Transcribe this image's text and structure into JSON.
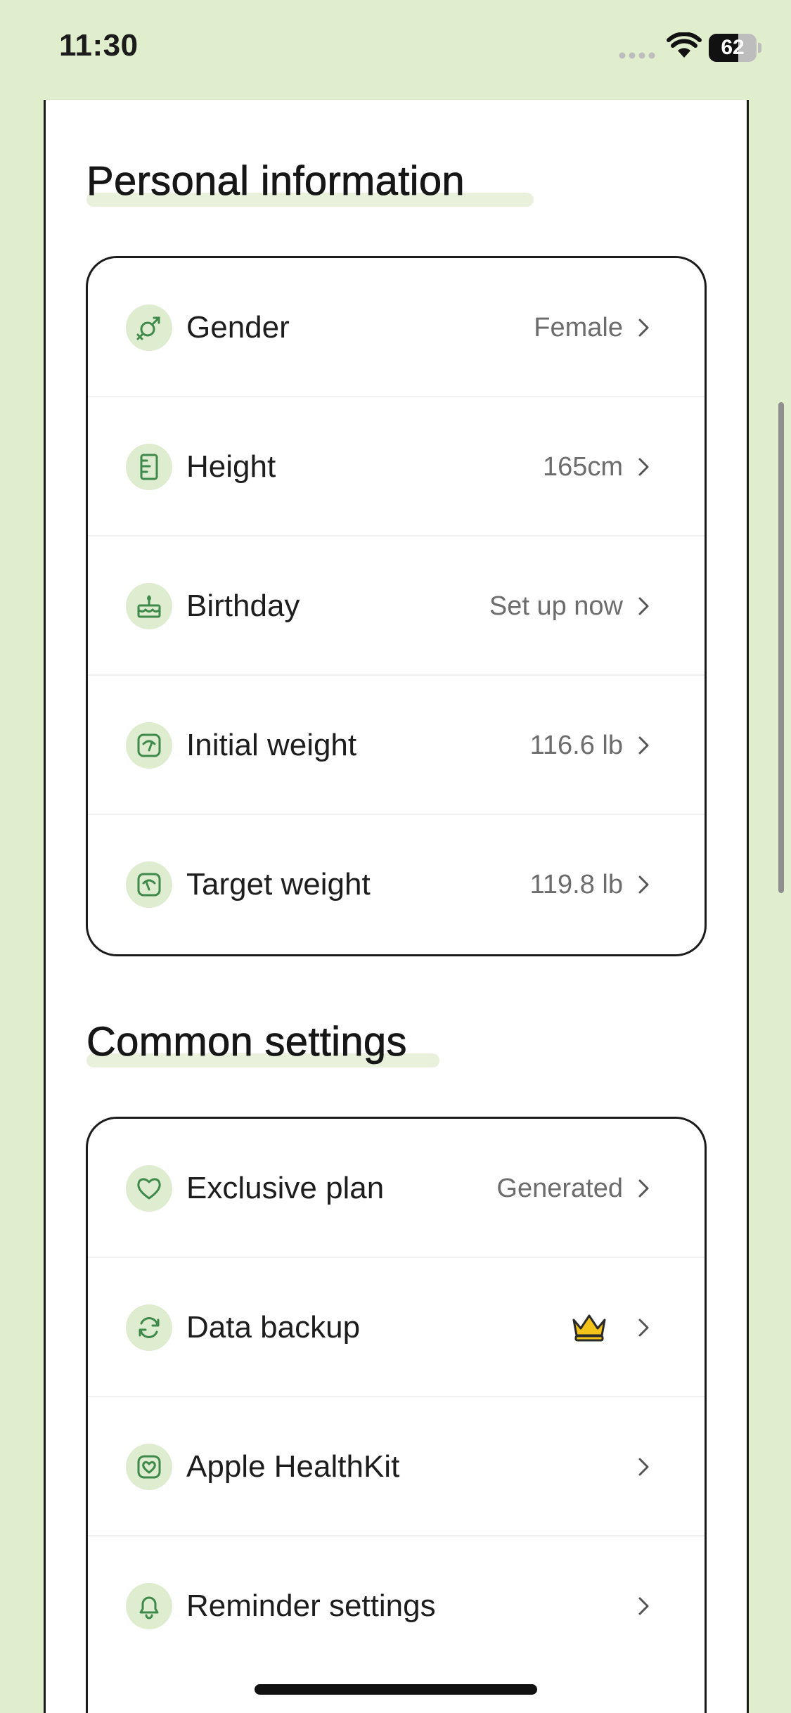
{
  "status_bar": {
    "time": "11:30",
    "battery_level": "62",
    "battery_fraction": 0.62
  },
  "personal": {
    "title": "Personal information",
    "rows": [
      {
        "icon": "gender-icon",
        "label": "Gender",
        "value": "Female"
      },
      {
        "icon": "ruler-icon",
        "label": "Height",
        "value": "165cm"
      },
      {
        "icon": "cake-icon",
        "label": "Birthday",
        "value": "Set up now"
      },
      {
        "icon": "scale-icon",
        "label": "Initial weight",
        "value": "116.6 lb"
      },
      {
        "icon": "scale-target-icon",
        "label": "Target weight",
        "value": "119.8 lb"
      }
    ]
  },
  "common": {
    "title": "Common settings",
    "rows": [
      {
        "icon": "heart-icon",
        "label": "Exclusive plan",
        "value": "Generated"
      },
      {
        "icon": "sync-icon",
        "label": "Data backup",
        "badge": "crown-icon"
      },
      {
        "icon": "health-icon",
        "label": "Apple HealthKit"
      },
      {
        "icon": "bell-icon",
        "label": "Reminder settings"
      }
    ]
  },
  "colors": {
    "background": "#e1eecd",
    "icon_bg": "#deecd0",
    "icon_stroke": "#3f8a4a",
    "text": "#1d1d1d",
    "value_text": "#6c6c6c",
    "crown": "#f3c31a"
  }
}
